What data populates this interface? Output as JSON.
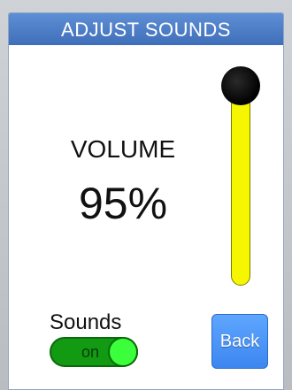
{
  "window": {
    "title": "ADJUST SOUNDS"
  },
  "volume": {
    "label": "VOLUME",
    "value_text": "95%",
    "level_percent": 95
  },
  "sounds": {
    "label": "Sounds",
    "toggle_text": "on",
    "enabled": true
  },
  "buttons": {
    "back_label": "Back"
  },
  "colors": {
    "title_bar": "#4a7dc8",
    "slider_track": "#f6f600",
    "slider_thumb": "#000000",
    "toggle_on": "#129a12",
    "toggle_knob": "#3cff3c",
    "back_button": "#4a95f8"
  }
}
